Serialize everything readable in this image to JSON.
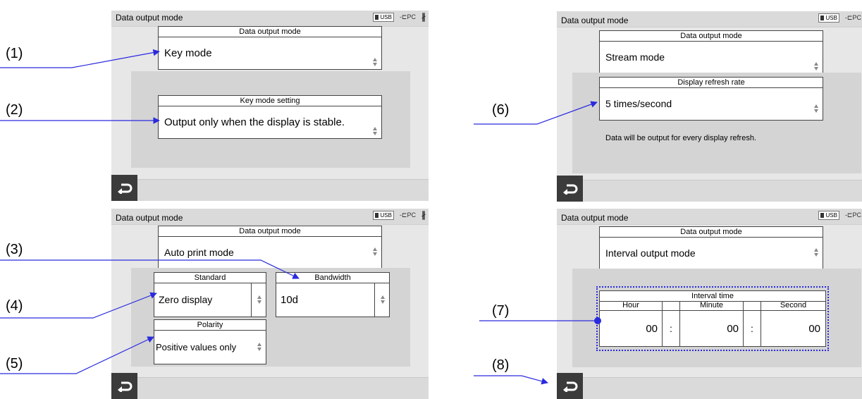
{
  "header_title": "Data output mode",
  "icons": {
    "usb_label": "USB",
    "pc_label": "PC",
    "bluetooth": "bluetooth-icon"
  },
  "annotations": [
    "(1)",
    "(2)",
    "(3)",
    "(4)",
    "(5)",
    "(6)",
    "(7)",
    "(8)"
  ],
  "screen1": {
    "mode_title": "Data output mode",
    "mode_value": "Key mode",
    "key_setting_title": "Key mode setting",
    "key_setting_value": "Output only when the display is stable."
  },
  "screen2": {
    "mode_title": "Data output mode",
    "mode_value": "Stream mode",
    "refresh_title": "Display refresh rate",
    "refresh_value": "5 times/second",
    "note": "Data will be output for every display refresh."
  },
  "screen3": {
    "mode_title": "Data output mode",
    "mode_value": "Auto print mode",
    "standard_title": "Standard",
    "standard_value": "Zero display",
    "bandwidth_title": "Bandwidth",
    "bandwidth_value": "10d",
    "polarity_title": "Polarity",
    "polarity_value": "Positive values only"
  },
  "screen4": {
    "mode_title": "Data output mode",
    "mode_value": "Interval output mode",
    "interval_title": "Interval time",
    "hour_label": "Hour",
    "minute_label": "Minute",
    "second_label": "Second",
    "hour_value": "00",
    "minute_value": "00",
    "second_value": "00",
    "colon": ":"
  },
  "colors": {
    "arrow": "#2a2adf",
    "back_button": "#3b3b3b",
    "panel": "#d4d4d4"
  }
}
